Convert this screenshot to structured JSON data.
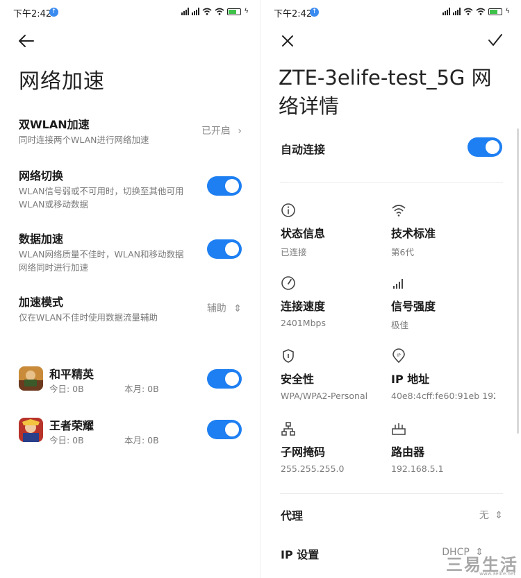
{
  "left": {
    "status": {
      "time": "下午2:42"
    },
    "title": "网络加速",
    "dual_wlan": {
      "title": "双WLAN加速",
      "sub": "同时连接两个WLAN进行网络加速",
      "value": "已开启"
    },
    "network_switch": {
      "title": "网络切换",
      "sub1": "WLAN信号弱或不可用时，切换至其他可用",
      "sub2": "WLAN或移动数据"
    },
    "data_accel": {
      "title": "数据加速",
      "sub1": "WLAN网络质量不佳时，WLAN和移动数据",
      "sub2": "网络同时进行加速"
    },
    "accel_mode": {
      "title": "加速模式",
      "sub": "仅在WLAN不佳时使用数据流量辅助",
      "value": "辅助"
    },
    "apps": [
      {
        "name": "和平精英",
        "today": "今日: 0B",
        "month": "本月: 0B"
      },
      {
        "name": "王者荣耀",
        "today": "今日: 0B",
        "month": "本月: 0B"
      }
    ]
  },
  "right": {
    "status": {
      "time": "下午2:42"
    },
    "title": "ZTE-3elife-test_5G 网络详情",
    "auto_connect": "自动连接",
    "cells": [
      {
        "label": "状态信息",
        "value": "已连接",
        "icon": "info-icon"
      },
      {
        "label": "技术标准",
        "value": "第6代",
        "icon": "wifi-icon"
      },
      {
        "label": "连接速度",
        "value": "2401Mbps",
        "icon": "speed-gauge-icon"
      },
      {
        "label": "信号强度",
        "value": "极佳",
        "icon": "signal-bars-icon"
      },
      {
        "label": "安全性",
        "value": "WPA/WPA2-Personal",
        "icon": "shield-icon"
      },
      {
        "label": "IP 地址",
        "value": "40e8:4cff:fe60:91eb 192",
        "icon": "ip-pin-icon"
      },
      {
        "label": "子网掩码",
        "value": "255.255.255.0",
        "icon": "subnet-icon"
      },
      {
        "label": "路由器",
        "value": "192.168.5.1",
        "icon": "router-icon"
      }
    ],
    "proxy": {
      "label": "代理",
      "value": "无"
    },
    "ip_settings": {
      "label": "IP 设置",
      "value": "DHCP"
    },
    "watermark": "三易生活",
    "watermark_url": "www.3elife.net"
  },
  "colors": {
    "accent": "#1e7ff2",
    "secondary_text": "#7a7a7a"
  }
}
